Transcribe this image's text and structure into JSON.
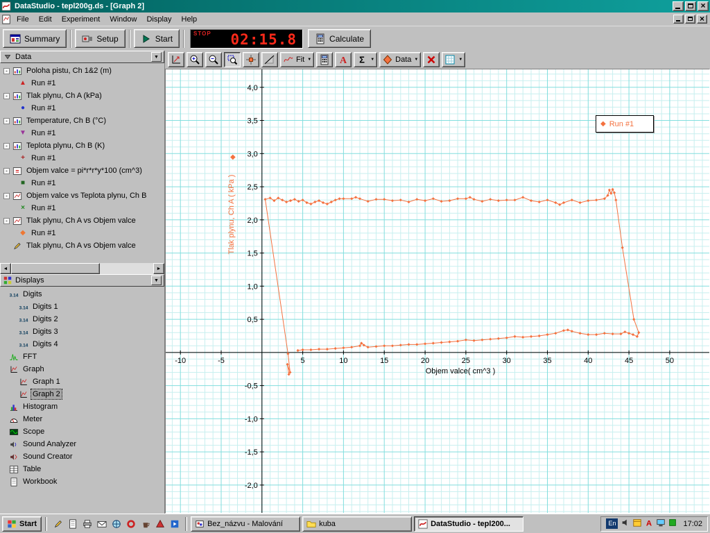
{
  "window": {
    "title": "DataStudio - tepl200g.ds - [Graph 2]",
    "controls": [
      "minimize",
      "maximize",
      "close"
    ],
    "mdi_controls": [
      "minimize",
      "restore",
      "close"
    ]
  },
  "menu": {
    "items": [
      "File",
      "Edit",
      "Experiment",
      "Window",
      "Display",
      "Help"
    ]
  },
  "toolbar": {
    "buttons": [
      {
        "name": "summary-button",
        "icon": "summary-icon",
        "label": "Summary"
      },
      {
        "name": "setup-button",
        "icon": "setup-icon",
        "label": "Setup"
      },
      {
        "name": "start-button",
        "icon": "start-icon",
        "label": "Start"
      }
    ],
    "timer": {
      "stop_label": "STOP",
      "value": "02:15.8",
      "color": "#ff2a1a",
      "background": "#000000"
    },
    "calculate_label": "Calculate"
  },
  "graph_toolbar": {
    "buttons": [
      {
        "name": "scale-to-fit-button",
        "icon": "scale-to-fit-icon"
      },
      {
        "name": "zoom-in-button",
        "icon": "zoom-in-icon"
      },
      {
        "name": "zoom-out-button",
        "icon": "zoom-out-icon"
      },
      {
        "name": "zoom-select-button",
        "icon": "zoom-select-icon",
        "pressed": true
      },
      {
        "name": "smart-tool-button",
        "icon": "smart-tool-icon"
      },
      {
        "name": "slope-tool-button",
        "icon": "slope-tool-icon"
      },
      {
        "name": "fit-menu-button",
        "icon": "fit-icon",
        "label": "Fit",
        "dropdown": true
      },
      {
        "name": "calculator-button",
        "icon": "calculator-icon"
      },
      {
        "name": "text-annotation-button",
        "icon": "text-a-icon"
      },
      {
        "name": "statistics-menu-button",
        "icon": "sigma-icon",
        "dropdown": true
      },
      {
        "name": "data-menu-button",
        "icon": "data-diamond-icon",
        "label": "Data",
        "dropdown": true
      },
      {
        "name": "delete-button",
        "icon": "delete-x-icon"
      },
      {
        "name": "graph-settings-button",
        "icon": "graph-settings-icon",
        "dropdown": true
      }
    ]
  },
  "data_panel": {
    "header": "Data",
    "items": [
      {
        "label": "Poloha pistu, Ch 1&2 (m)",
        "icon": "measurement-icon",
        "runs": [
          {
            "label": "Run #1",
            "marker": "triangle-up",
            "color": "#cc2222"
          }
        ]
      },
      {
        "label": "Tlak plynu, Ch A (kPa)",
        "icon": "measurement-icon",
        "runs": [
          {
            "label": "Run #1",
            "marker": "circle",
            "color": "#2233cc"
          }
        ]
      },
      {
        "label": "Temperature, Ch B (°C)",
        "icon": "measurement-icon",
        "runs": [
          {
            "label": "Run #1",
            "marker": "triangle-down",
            "color": "#993399"
          }
        ]
      },
      {
        "label": "Teplota plynu, Ch B (K)",
        "icon": "measurement-icon",
        "runs": [
          {
            "label": "Run #1",
            "marker": "plus",
            "color": "#aa2222"
          }
        ]
      },
      {
        "label": "Objem valce = pi*r*r*y*100 (cm^3)",
        "icon": "formula-icon",
        "runs": [
          {
            "label": "Run #1",
            "marker": "square",
            "color": "#226622"
          }
        ]
      },
      {
        "label": "Objem valce vs Teplota plynu, Ch B",
        "icon": "graphdata-icon",
        "runs": [
          {
            "label": "Run #1",
            "marker": "x-cross",
            "color": "#228822"
          }
        ]
      },
      {
        "label": "Tlak plynu, Ch A vs Objem valce",
        "icon": "graphdata-icon",
        "runs": [
          {
            "label": "Run #1",
            "marker": "diamond",
            "color": "#ee7733"
          }
        ]
      },
      {
        "label": "Tlak plynu, Ch A vs Objem valce",
        "icon": "pencil-icon",
        "runs": []
      }
    ]
  },
  "displays_panel": {
    "header": "Displays",
    "items": [
      {
        "label": "Digits",
        "icon": "digits-icon",
        "children": [
          {
            "label": "Digits 1",
            "icon": "digits-icon"
          },
          {
            "label": "Digits 2",
            "icon": "digits-icon"
          },
          {
            "label": "Digits 3",
            "icon": "digits-icon"
          },
          {
            "label": "Digits 4",
            "icon": "digits-icon"
          }
        ]
      },
      {
        "label": "FFT",
        "icon": "fft-icon",
        "children": []
      },
      {
        "label": "Graph",
        "icon": "graph-icon",
        "children": [
          {
            "label": "Graph 1",
            "icon": "graph-icon"
          },
          {
            "label": "Graph 2",
            "icon": "graph-icon",
            "selected": true
          }
        ]
      },
      {
        "label": "Histogram",
        "icon": "histogram-icon",
        "children": []
      },
      {
        "label": "Meter",
        "icon": "meter-icon",
        "children": []
      },
      {
        "label": "Scope",
        "icon": "scope-icon",
        "children": []
      },
      {
        "label": "Sound Analyzer",
        "icon": "sound-analyzer-icon",
        "children": []
      },
      {
        "label": "Sound Creator",
        "icon": "sound-creator-icon",
        "children": []
      },
      {
        "label": "Table",
        "icon": "table-icon",
        "children": []
      },
      {
        "label": "Workbook",
        "icon": "workbook-icon",
        "children": []
      }
    ]
  },
  "chart_data": {
    "type": "scatter",
    "title": "",
    "xlabel": "Objem valce( cm^3 )",
    "ylabel": "Tlak plynu, Ch A ( kPa )",
    "xlim": [
      -11.8,
      54.85
    ],
    "ylim": [
      -2.42,
      4.27
    ],
    "x_minor": 1,
    "x_major": 5,
    "y_minor": 0.1,
    "y_major": 0.5,
    "grid": true,
    "grid_minor_color": "#c8efef",
    "grid_major_color": "#82dede",
    "axis_color": "#000000",
    "x_ticks": [
      [
        -10,
        "-10"
      ],
      [
        -5,
        "-5"
      ],
      [
        5,
        "5"
      ],
      [
        10,
        "10"
      ],
      [
        15,
        "15"
      ],
      [
        20,
        "20"
      ],
      [
        25,
        "25"
      ],
      [
        30,
        "30"
      ],
      [
        35,
        "35"
      ],
      [
        40,
        "40"
      ],
      [
        45,
        "45"
      ],
      [
        50,
        "50"
      ]
    ],
    "y_ticks": [
      [
        4,
        "4,0"
      ],
      [
        3.5,
        "3,5"
      ],
      [
        3,
        "3,0"
      ],
      [
        2.5,
        "2,5"
      ],
      [
        2,
        "2,0"
      ],
      [
        1.5,
        "1,5"
      ],
      [
        1,
        "1,0"
      ],
      [
        0.5,
        "0,5"
      ],
      [
        -0.5,
        "-0,5"
      ],
      [
        -1,
        "-1,0"
      ],
      [
        -1.5,
        "-1,5"
      ],
      [
        -2,
        "-2,0"
      ]
    ],
    "legend": {
      "position": "top-right"
    },
    "series": [
      {
        "name": "Run #1",
        "color": "#f4713f",
        "marker": "diamond",
        "points": [
          [
            3.3,
            -0.33
          ],
          [
            3.12,
            -0.18
          ],
          [
            3.45,
            -0.3
          ],
          [
            3.2,
            -0.02
          ],
          [
            0.4,
            2.31
          ],
          [
            1,
            2.33
          ],
          [
            1.5,
            2.29
          ],
          [
            2,
            2.33
          ],
          [
            2.5,
            2.3
          ],
          [
            3,
            2.27
          ],
          [
            3.5,
            2.29
          ],
          [
            4,
            2.31
          ],
          [
            4.5,
            2.28
          ],
          [
            5,
            2.3
          ],
          [
            5.5,
            2.26
          ],
          [
            6,
            2.24
          ],
          [
            6.5,
            2.27
          ],
          [
            7,
            2.29
          ],
          [
            7.5,
            2.26
          ],
          [
            8,
            2.24
          ],
          [
            8.5,
            2.27
          ],
          [
            9,
            2.3
          ],
          [
            9.5,
            2.32
          ],
          [
            10,
            2.32
          ],
          [
            11,
            2.32
          ],
          [
            11.5,
            2.34
          ],
          [
            12,
            2.32
          ],
          [
            13,
            2.28
          ],
          [
            14,
            2.31
          ],
          [
            15,
            2.31
          ],
          [
            16,
            2.29
          ],
          [
            17,
            2.3
          ],
          [
            18,
            2.27
          ],
          [
            19,
            2.31
          ],
          [
            20,
            2.29
          ],
          [
            21,
            2.32
          ],
          [
            22,
            2.28
          ],
          [
            23,
            2.29
          ],
          [
            24,
            2.32
          ],
          [
            25,
            2.32
          ],
          [
            25.5,
            2.34
          ],
          [
            26,
            2.31
          ],
          [
            27,
            2.28
          ],
          [
            28,
            2.31
          ],
          [
            29,
            2.29
          ],
          [
            30,
            2.3
          ],
          [
            31,
            2.3
          ],
          [
            32,
            2.34
          ],
          [
            33,
            2.29
          ],
          [
            34,
            2.27
          ],
          [
            35,
            2.3
          ],
          [
            36,
            2.26
          ],
          [
            36.5,
            2.23
          ],
          [
            37,
            2.26
          ],
          [
            38,
            2.3
          ],
          [
            39,
            2.26
          ],
          [
            40,
            2.29
          ],
          [
            41,
            2.3
          ],
          [
            42,
            2.32
          ],
          [
            42.4,
            2.37
          ],
          [
            42.6,
            2.45
          ],
          [
            42.8,
            2.4
          ],
          [
            43,
            2.46
          ],
          [
            43.2,
            2.41
          ],
          [
            43.4,
            2.3
          ],
          [
            44.2,
            1.58
          ],
          [
            45.6,
            0.5
          ],
          [
            46.2,
            0.3
          ],
          [
            46,
            0.24
          ],
          [
            45.5,
            0.27
          ],
          [
            45,
            0.29
          ],
          [
            44.5,
            0.31
          ],
          [
            44,
            0.28
          ],
          [
            43,
            0.28
          ],
          [
            42,
            0.29
          ],
          [
            41,
            0.27
          ],
          [
            40,
            0.27
          ],
          [
            39,
            0.29
          ],
          [
            38,
            0.32
          ],
          [
            37.5,
            0.34
          ],
          [
            37,
            0.33
          ],
          [
            36,
            0.29
          ],
          [
            35,
            0.27
          ],
          [
            34,
            0.25
          ],
          [
            33,
            0.24
          ],
          [
            32,
            0.23
          ],
          [
            31,
            0.24
          ],
          [
            30,
            0.22
          ],
          [
            29,
            0.21
          ],
          [
            28,
            0.2
          ],
          [
            27,
            0.19
          ],
          [
            26,
            0.18
          ],
          [
            25,
            0.19
          ],
          [
            24,
            0.17
          ],
          [
            23,
            0.16
          ],
          [
            22,
            0.15
          ],
          [
            21,
            0.14
          ],
          [
            20,
            0.13
          ],
          [
            19,
            0.12
          ],
          [
            18,
            0.12
          ],
          [
            17,
            0.11
          ],
          [
            16,
            0.1
          ],
          [
            15,
            0.1
          ],
          [
            14,
            0.09
          ],
          [
            13,
            0.08
          ],
          [
            12.5,
            0.11
          ],
          [
            12.2,
            0.14
          ],
          [
            12,
            0.1
          ],
          [
            11,
            0.08
          ],
          [
            10,
            0.07
          ],
          [
            9,
            0.06
          ],
          [
            8,
            0.05
          ],
          [
            7,
            0.05
          ],
          [
            6,
            0.04
          ],
          [
            5,
            0.04
          ],
          [
            4.4,
            0.03
          ]
        ]
      }
    ]
  },
  "taskbar": {
    "start_label": "Start",
    "quick_launch": [
      {
        "name": "quick-launch-notes",
        "icon": "pencil-icon"
      },
      {
        "name": "quick-launch-document",
        "icon": "workbook-icon"
      },
      {
        "name": "quick-launch-printer",
        "icon": "printer-icon"
      },
      {
        "name": "quick-launch-mail",
        "icon": "mail-icon"
      },
      {
        "name": "quick-launch-browser",
        "icon": "globe-icon"
      },
      {
        "name": "quick-launch-opera",
        "icon": "opera-icon"
      },
      {
        "name": "quick-launch-java",
        "icon": "cup-icon"
      },
      {
        "name": "quick-launch-player",
        "icon": "player-icon"
      },
      {
        "name": "quick-launch-media",
        "icon": "media-icon"
      }
    ],
    "tasks": [
      {
        "label": "Bez_názvu - Malování",
        "icon": "paint-icon",
        "active": false
      },
      {
        "label": "kuba",
        "icon": "folder-icon",
        "active": false
      },
      {
        "label": "DataStudio - tepl200...",
        "icon": "datastudio-icon",
        "active": true
      }
    ],
    "tray": {
      "lang": "En",
      "icons": [
        {
          "name": "tray-volume",
          "icon": "speaker-icon"
        },
        {
          "name": "tray-scheduler",
          "icon": "calendar-icon"
        },
        {
          "name": "tray-antivirus",
          "icon": "red-a-icon"
        },
        {
          "name": "tray-display",
          "icon": "monitor-icon"
        },
        {
          "name": "tray-updater",
          "icon": "green-square-icon"
        }
      ],
      "time": "17:02"
    }
  },
  "theme": {
    "titlebar_start": "#02615e",
    "titlebar_end": "#0fa09d",
    "button_face": "#c0c0c0",
    "series_orange": "#f4713f",
    "timer_red": "#ff2a1a",
    "selection_gray": "#a6a6a6"
  }
}
